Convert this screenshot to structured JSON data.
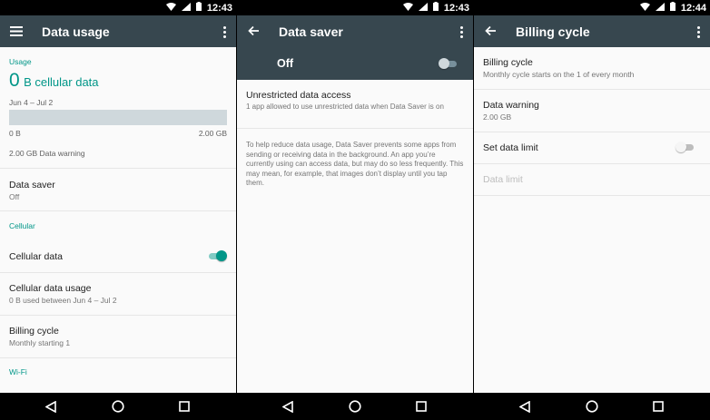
{
  "screens": [
    {
      "status": {
        "time": "12:43"
      },
      "appbar": {
        "title": "Data usage",
        "nav_icon": "menu-icon"
      },
      "usage": {
        "section": "Usage",
        "amount": "0",
        "unit": "B cellular data",
        "range": "Jun 4 – Jul 2",
        "progress": 0,
        "min_label": "0 B",
        "max_label": "2.00 GB",
        "warning": "2.00 GB Data warning"
      },
      "data_saver": {
        "title": "Data saver",
        "value": "Off"
      },
      "cellular": {
        "section": "Cellular",
        "cellular_data": {
          "title": "Cellular data",
          "on": true
        },
        "usage": {
          "title": "Cellular data usage",
          "sub": "0 B used between Jun 4 – Jul 2"
        },
        "billing": {
          "title": "Billing cycle",
          "sub": "Monthly starting 1"
        }
      },
      "wifi": {
        "section": "Wi-Fi"
      }
    },
    {
      "status": {
        "time": "12:43"
      },
      "appbar": {
        "title": "Data saver",
        "nav_icon": "back-arrow-icon"
      },
      "master": {
        "label": "Off",
        "on": false
      },
      "unrestricted": {
        "title": "Unrestricted data access",
        "sub": "1 app allowed to use unrestricted data when Data Saver is on"
      },
      "description": "To help reduce data usage, Data Saver prevents some apps from sending or receiving data in the background. An app you’re currently using can access data, but may do so less frequently. This may mean, for example, that images don’t display until you tap them."
    },
    {
      "status": {
        "time": "12:44"
      },
      "appbar": {
        "title": "Billing cycle",
        "nav_icon": "back-arrow-icon"
      },
      "billing": {
        "title": "Billing cycle",
        "sub": "Monthly cycle starts on the 1 of every month"
      },
      "warning": {
        "title": "Data warning",
        "sub": "2.00 GB"
      },
      "limit": {
        "title": "Set data limit",
        "on": false
      },
      "data_limit": {
        "title": "Data limit"
      }
    }
  ],
  "colors": {
    "accent": "#009688",
    "appbar": "#37474f",
    "background": "#fafafa"
  }
}
